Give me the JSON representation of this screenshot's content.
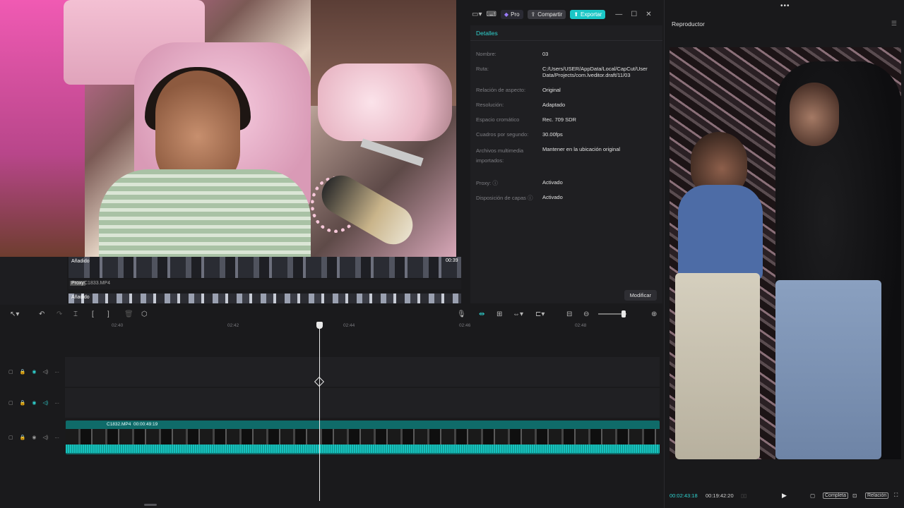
{
  "topbar": {
    "pro_label": "Pro",
    "share_label": "Compartir",
    "export_label": "Exportar"
  },
  "details": {
    "header": "Detalles",
    "rows": [
      {
        "key": "Nombre:",
        "value": "03"
      },
      {
        "key": "Ruta:",
        "value": "C:/Users/USER/AppData/Local/CapCut/User Data/Projects/com.lveditor.draft/11/03"
      },
      {
        "key": "Relación de aspecto:",
        "value": "Original"
      },
      {
        "key": "Resolución:",
        "value": "Adaptado"
      },
      {
        "key": "Espacio cromático",
        "value": "Rec. 709 SDR"
      },
      {
        "key": "Cuadros por segundo:",
        "value": "30.00fps"
      },
      {
        "key": "Archivos multimedia importados:",
        "value": "Mantener en la ubicación original"
      },
      {
        "key": "Proxy: ⓘ",
        "value": "Activado"
      },
      {
        "key": "Disposición de capas ⓘ",
        "value": "Activado"
      }
    ],
    "modify_label": "Modificar"
  },
  "player": {
    "title": "Reproductor",
    "current_time": "00:02:43:18",
    "duration": "00:19:42:20",
    "complete_label": "Completa",
    "ratio_label": "Relación"
  },
  "webcam_strip": {
    "added_label_1": "Añadido",
    "proxy_label": "Proxy",
    "file_label": "C1833.MP4",
    "time_label": "00:39",
    "added_label_2": "Añadido"
  },
  "ruler": {
    "ticks": [
      "02:40",
      "02:42",
      "02:44",
      "02:46",
      "02:48"
    ]
  },
  "clip": {
    "name": "C1832.MP4",
    "duration": "00:00:49:19"
  },
  "icons": [
    "select-arrow-icon",
    "undo-icon",
    "redo-icon",
    "split-icon",
    "trim-left-icon",
    "trim-right-icon",
    "delete-icon",
    "marker-icon",
    "mic-icon",
    "link-icon",
    "zoom-out-icon",
    "zoom-in-icon",
    "play-icon",
    "fullscreen-icon"
  ]
}
